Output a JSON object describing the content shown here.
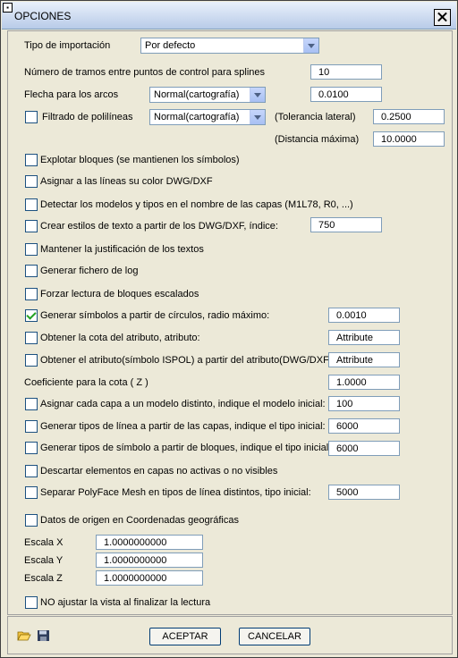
{
  "window": {
    "title": "OPCIONES"
  },
  "fields": {
    "tipo_importacion": {
      "label": "Tipo de importación",
      "value": "Por defecto"
    },
    "tramos": {
      "label": "Número de tramos entre puntos de control para splines",
      "value": "10"
    },
    "flecha": {
      "label": "Flecha para los arcos",
      "mode": "Normal(cartografía)",
      "value": "0.0100"
    },
    "filtrado": {
      "label": "Filtrado de polilíneas",
      "mode": "Normal(cartografía)",
      "tol_label": "(Tolerancia lateral)",
      "tol_value": "0.2500",
      "dist_label": "(Distancia máxima)",
      "dist_value": "10.0000"
    },
    "explotar": "Explotar bloques (se mantienen los símbolos)",
    "asignar_color": "Asignar a las líneas su color DWG/DXF",
    "detectar": "Detectar los modelos y tipos en el nombre de las capas (M1L78, R0, ...)",
    "crear_estilos": {
      "label": "Crear estilos de texto a partir de los DWG/DXF, índice:",
      "value": "750"
    },
    "mantener_just": "Mantener la justificación de los textos",
    "generar_log": "Generar fichero de log",
    "forzar_lectura": "Forzar lectura de bloques escalados",
    "generar_simbolos": {
      "label": "Generar símbolos a partir de círculos, radio máximo:",
      "value": "0.0010",
      "checked": true
    },
    "obtener_cota": {
      "label": "Obtener la cota del atributo, atributo:",
      "value": "Attribute"
    },
    "obtener_atributo": {
      "label": "Obtener el atributo(símbolo ISPOL) a partir del atributo(DWG/DXF):",
      "value": "Attribute"
    },
    "coeficiente": {
      "label": "Coeficiente para la cota ( Z )",
      "value": "1.0000"
    },
    "asignar_capa": {
      "label": "Asignar cada capa a un modelo distinto, indique el modelo inicial:",
      "value": "100"
    },
    "tipos_linea": {
      "label": "Generar tipos de línea a partir de las capas, indique el tipo inicial:",
      "value": "6000"
    },
    "tipos_simbolo": {
      "label": "Generar tipos de símbolo a partir de bloques, indique el tipo inicial:",
      "value": "6000"
    },
    "descartar": "Descartar elementos en capas no activas o no visibles",
    "separar": {
      "label": "Separar PolyFace Mesh en tipos de línea distintos, tipo inicial:",
      "value": "5000"
    },
    "datos_origen": "Datos de origen en Coordenadas geográficas",
    "escala_x": {
      "label": "Escala X",
      "value": "1.0000000000"
    },
    "escala_y": {
      "label": "Escala Y",
      "value": "1.0000000000"
    },
    "escala_z": {
      "label": "Escala Z",
      "value": "1.0000000000"
    },
    "no_ajustar": "NO ajustar la vista al finalizar la lectura"
  },
  "buttons": {
    "accept": "ACEPTAR",
    "cancel": "CANCELAR"
  },
  "icons": {
    "open": "folder-open-icon",
    "save": "floppy-disk-icon"
  }
}
